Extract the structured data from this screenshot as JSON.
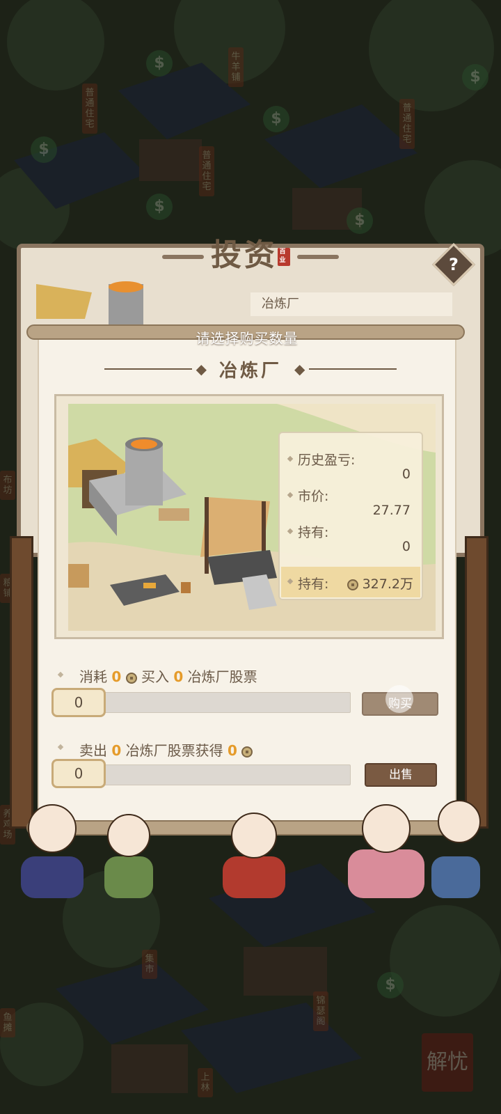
{
  "background": {
    "signs": [
      "普通住宅",
      "牛羊铺",
      "普通住宅",
      "普通住宅",
      "布坊",
      "粮铺",
      "养鸡场",
      "集市",
      "锦瑟阁",
      "鱼摊",
      "上林"
    ],
    "bubble_glyph": "$"
  },
  "back_panel": {
    "title": "投资",
    "seal_text": "百业",
    "help_label": "?",
    "item_name": "冶炼厂"
  },
  "dialog": {
    "header": "请选择购买数量",
    "building_name": "冶炼厂",
    "stats": {
      "history_label": "历史盈亏:",
      "history_value": "0",
      "price_label": "市价:",
      "price_value": "27.77",
      "holding_label": "持有:",
      "holding_value": "0",
      "wealth_label": "持有:",
      "wealth_value": "327.2万"
    },
    "buy": {
      "consume_label": "消耗",
      "consume_value": "0",
      "buy_in_label": "买入",
      "buy_in_value": "0",
      "stock_label": "冶炼厂股票",
      "quantity": "0",
      "slider_fraction": 0,
      "button_label": "购买"
    },
    "sell": {
      "sell_label": "卖出",
      "sell_value": "0",
      "stock_gain_label": "冶炼厂股票获得",
      "gain_value": "0",
      "quantity": "0",
      "slider_fraction": 0,
      "button_label": "出售"
    }
  },
  "stamp_text": "解忧",
  "colors": {
    "accent_number": "#e59b2a",
    "panel_bg": "#f7f2e8",
    "brown_button": "#7a5a42"
  }
}
